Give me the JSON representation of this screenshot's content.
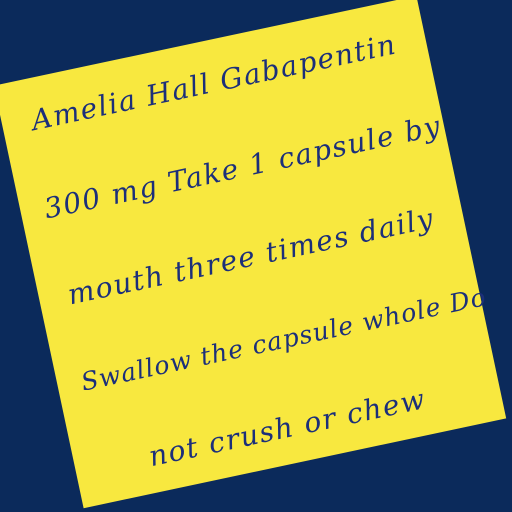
{
  "background_color": "#0b2a5b",
  "note": {
    "color": "#f8e83f",
    "text_color": "#1c2f7a",
    "lines": [
      "Amelia Hall Gabapentin",
      "300 mg Take 1 capsule by",
      "mouth three times daily",
      "Swallow the capsule whole Do",
      "not crush or chew"
    ]
  }
}
